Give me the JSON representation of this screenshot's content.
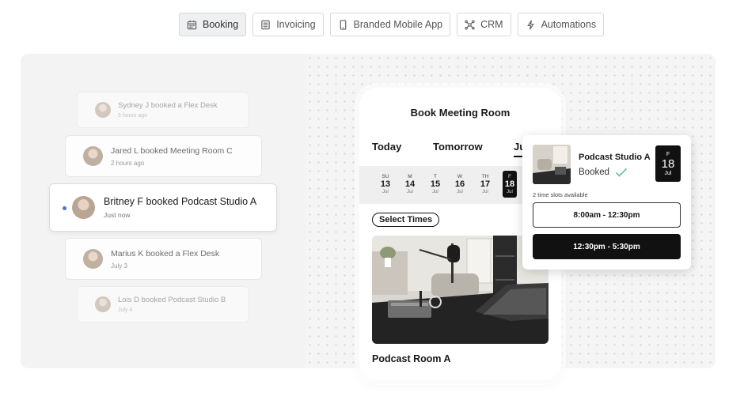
{
  "tabs": [
    {
      "label": "Booking",
      "icon": "calendar-icon",
      "active": true
    },
    {
      "label": "Invoicing",
      "icon": "invoice-icon",
      "active": false
    },
    {
      "label": "Branded Mobile App",
      "icon": "mobile-icon",
      "active": false
    },
    {
      "label": "CRM",
      "icon": "network-icon",
      "active": false
    },
    {
      "label": "Automations",
      "icon": "lightning-icon",
      "active": false
    }
  ],
  "activity": [
    {
      "title": "Sydney J booked a Flex Desk",
      "time": "5 hours ago"
    },
    {
      "title": "Jared L booked Meeting Room C",
      "time": "2 hours ago"
    },
    {
      "title": "Britney F booked Podcast Studio A",
      "time": "Just now"
    },
    {
      "title": "Marius K booked a Flex Desk",
      "time": "July 3"
    },
    {
      "title": "Lois D booked Podcast Studio B",
      "time": "July 4"
    }
  ],
  "phone": {
    "title": "Book Meeting Room",
    "day_tabs": {
      "today": "Today",
      "tomorrow": "Tomorrow",
      "july": "Ju"
    },
    "dates": [
      {
        "dow": "SU",
        "num": "13",
        "mon": "Jul"
      },
      {
        "dow": "M",
        "num": "14",
        "mon": "Jul"
      },
      {
        "dow": "T",
        "num": "15",
        "mon": "Jul"
      },
      {
        "dow": "W",
        "num": "16",
        "mon": "Jul"
      },
      {
        "dow": "TH",
        "num": "17",
        "mon": "Jul"
      },
      {
        "dow": "F",
        "num": "18",
        "mon": "Jul"
      }
    ],
    "select_times": "Select Times",
    "room_name": "Podcast Room A"
  },
  "popup": {
    "title": "Podcast Studio A",
    "status": "Booked",
    "date": {
      "dow": "F",
      "num": "18",
      "mon": "Jul"
    },
    "slots_label": "2 time slots available",
    "slots": [
      "8:00am - 12:30pm",
      "12:30pm - 5:30pm"
    ]
  },
  "colors": {
    "accent_dot": "#4a72e0",
    "check": "#6cc3a0",
    "dark": "#111111"
  }
}
